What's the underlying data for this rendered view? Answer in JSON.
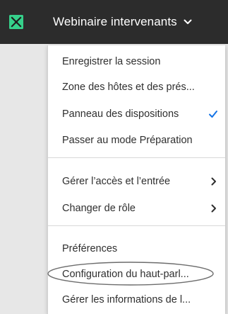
{
  "header": {
    "title": "Webinaire intervenants",
    "logo_icon": "adobe-connect-logo",
    "chevron_icon": "chevron-down-icon"
  },
  "colors": {
    "topbar_bg": "#2c2c2c",
    "logo_accent": "#36d18b",
    "check_accent": "#1473e6",
    "menu_bg": "#ffffff"
  },
  "menu": {
    "items": [
      {
        "label": "Enregistrer la session"
      },
      {
        "label": "Zone des hôtes et des prés..."
      },
      {
        "label": "Panneau des dispositions",
        "checked": true,
        "icon": "checkmark-icon"
      },
      {
        "label": "Passer au mode Préparation"
      },
      {
        "label": "Gérer l’accès et l’entrée",
        "submenu": true,
        "icon": "chevron-right-icon"
      },
      {
        "label": "Changer de rôle",
        "submenu": true,
        "icon": "chevron-right-icon"
      },
      {
        "label": "Préférences"
      },
      {
        "label": "Configuration du haut-parl...",
        "highlighted": true
      },
      {
        "label": "Gérer les informations de l..."
      }
    ]
  }
}
